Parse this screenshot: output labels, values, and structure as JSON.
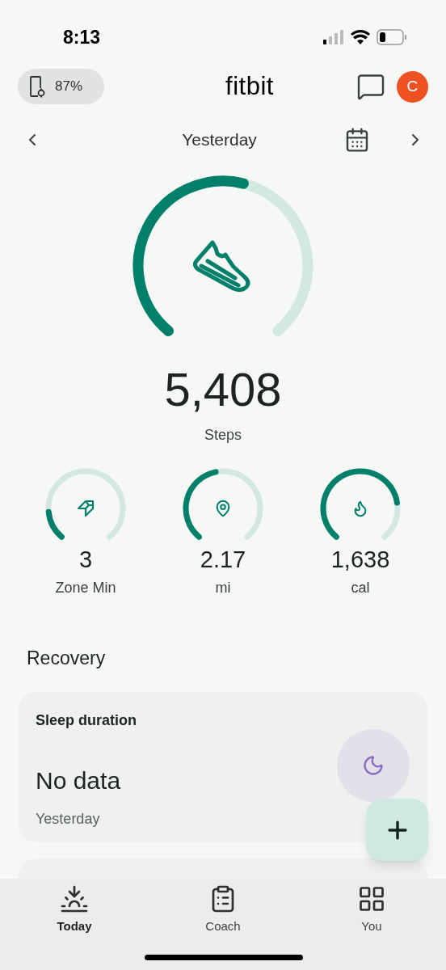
{
  "status_bar": {
    "time": "8:13"
  },
  "header": {
    "device_battery": "87%",
    "logo": "fitbit",
    "avatar": "C"
  },
  "date_nav": {
    "label": "Yesterday"
  },
  "steps": {
    "value": "5,408",
    "label": "Steps"
  },
  "stats": [
    {
      "kind": "zone",
      "value": "3",
      "label": "Zone Min"
    },
    {
      "kind": "distance",
      "value": "2.17",
      "label": "mi"
    },
    {
      "kind": "calories",
      "value": "1,638",
      "label": "cal"
    }
  ],
  "section_title": "Recovery",
  "sleep_card": {
    "title": "Sleep duration",
    "value": "No data",
    "date": "Yesterday"
  },
  "bottom_nav": [
    {
      "kind": "today",
      "label": "Today",
      "selected": true
    },
    {
      "kind": "coach",
      "label": "Coach",
      "selected": false
    },
    {
      "kind": "you",
      "label": "You",
      "selected": false
    }
  ]
}
